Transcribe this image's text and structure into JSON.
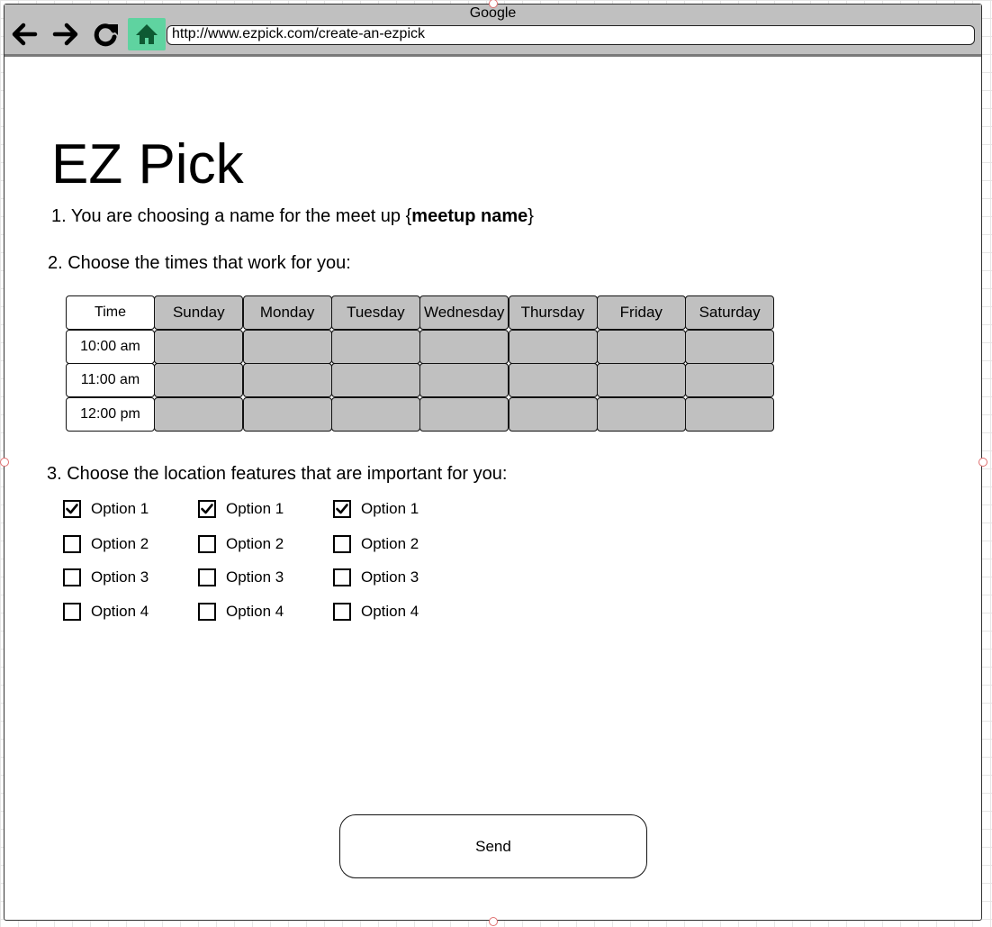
{
  "browser": {
    "title": "Google",
    "url": "http://www.ezpick.com/create-an-ezpick",
    "accent_color": "#5fd3a0"
  },
  "page": {
    "title": "EZ Pick",
    "step1": {
      "prefix": "1. You are choosing a name for the meet up {",
      "name": "meetup name",
      "suffix": "}"
    },
    "step2": "2. Choose the times that work for you:",
    "step3": "3. Choose the location features that are important for you:"
  },
  "schedule": {
    "corner_label": "Time",
    "days": [
      "Sunday",
      "Monday",
      "Tuesday",
      "Wednesday",
      "Thursday",
      "Friday",
      "Saturday"
    ],
    "times": [
      "10:00 am",
      "11:00 am",
      "12:00 pm"
    ],
    "slot_color": "#c0c0c0"
  },
  "features": {
    "columns": [
      [
        {
          "label": "Option 1",
          "checked": true
        },
        {
          "label": "Option 2",
          "checked": false
        },
        {
          "label": "Option 3",
          "checked": false
        },
        {
          "label": "Option 4",
          "checked": false
        }
      ],
      [
        {
          "label": "Option 1",
          "checked": true
        },
        {
          "label": "Option 2",
          "checked": false
        },
        {
          "label": "Option 3",
          "checked": false
        },
        {
          "label": "Option 4",
          "checked": false
        }
      ],
      [
        {
          "label": "Option 1",
          "checked": true
        },
        {
          "label": "Option 2",
          "checked": false
        },
        {
          "label": "Option 3",
          "checked": false
        },
        {
          "label": "Option 4",
          "checked": false
        }
      ]
    ]
  },
  "actions": {
    "send_label": "Send"
  }
}
